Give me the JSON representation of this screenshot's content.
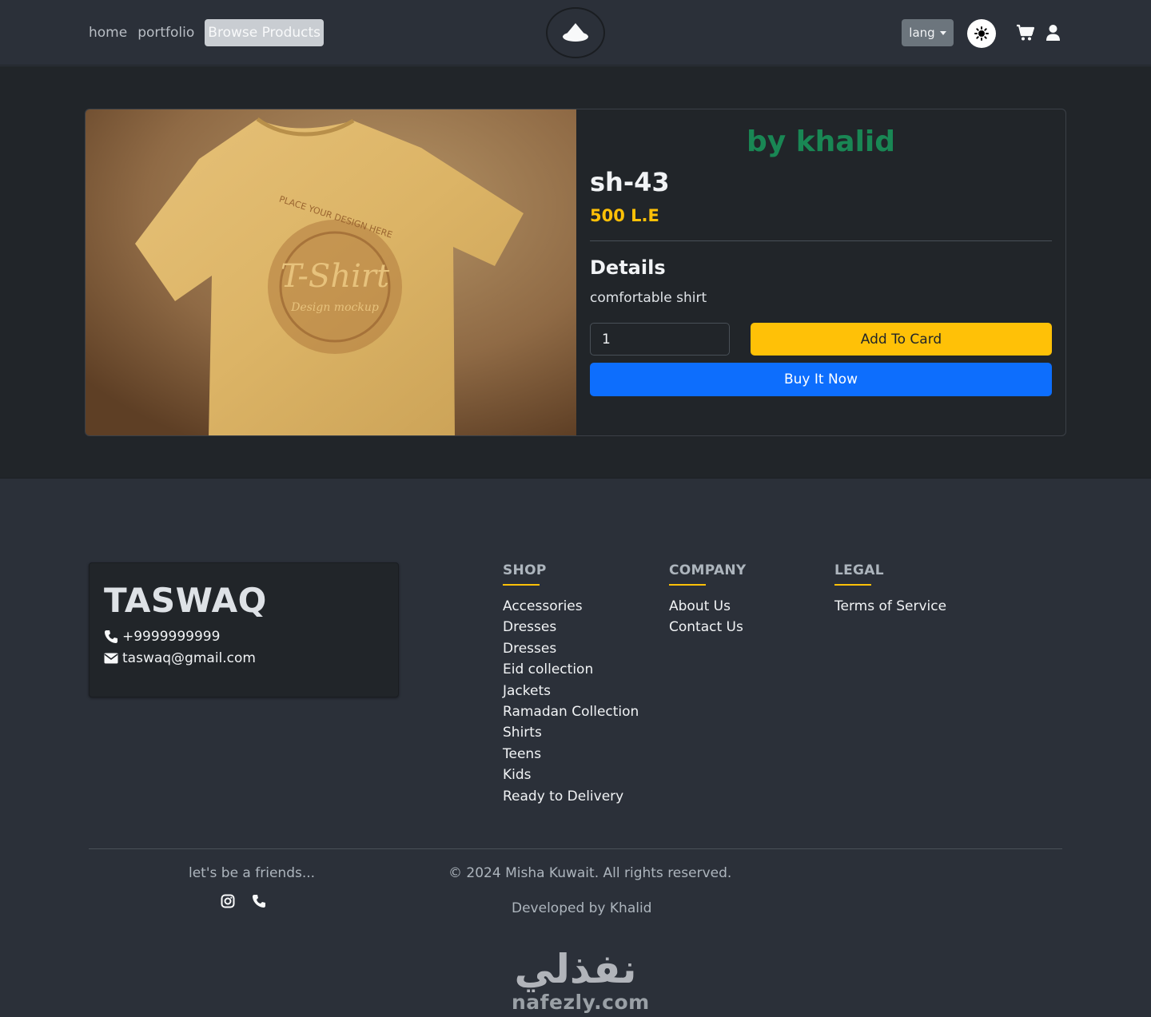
{
  "navbar": {
    "links": [
      "home",
      "portfolio"
    ],
    "active_link": "Browse Products",
    "lang_label": "lang",
    "icons": {
      "logo": "cloud-upload-icon",
      "theme": "sun-icon",
      "cart": "cart-icon",
      "user": "user-icon"
    }
  },
  "product": {
    "seller": "by khalid",
    "name": "sh-43",
    "price": "500 L.E",
    "details_title": "Details",
    "details_text": "comfortable shirt",
    "quantity": "1",
    "add_label": "Add To Card",
    "buy_label": "Buy It Now",
    "image": "yellow-tshirt-photo",
    "image_text": {
      "line1": "T-Shirt",
      "line2": "Design mockup",
      "ring": "PLACE YOUR DESIGN HERE"
    }
  },
  "footer": {
    "brand": "TASWAQ",
    "phone": "+9999999999",
    "email": "taswaq@gmail.com",
    "shop": {
      "title": "SHOP",
      "links": [
        "Accessories",
        "Dresses",
        "Dresses",
        "Eid collection",
        "Jackets",
        "Ramadan Collection",
        "Shirts",
        "Teens",
        "Kids",
        "Ready to Delivery"
      ]
    },
    "company": {
      "title": "COMPANY",
      "links": [
        "About Us",
        "Contact Us"
      ]
    },
    "legal": {
      "title": "LEGAL",
      "links": [
        "Terms of Service"
      ]
    },
    "friends": "let's be a friends...",
    "copyright": "© 2024 Misha Kuwait. All rights reserved.",
    "developed": "Developed by Khalid",
    "watermark_url": "nafezly.com",
    "watermark_arabic": "نفذلي"
  },
  "colors": {
    "accent_yellow": "#ffc107",
    "primary_blue": "#0d6efd",
    "seller_green": "#198754",
    "background": "#2b3039",
    "section_bg": "#212529"
  }
}
